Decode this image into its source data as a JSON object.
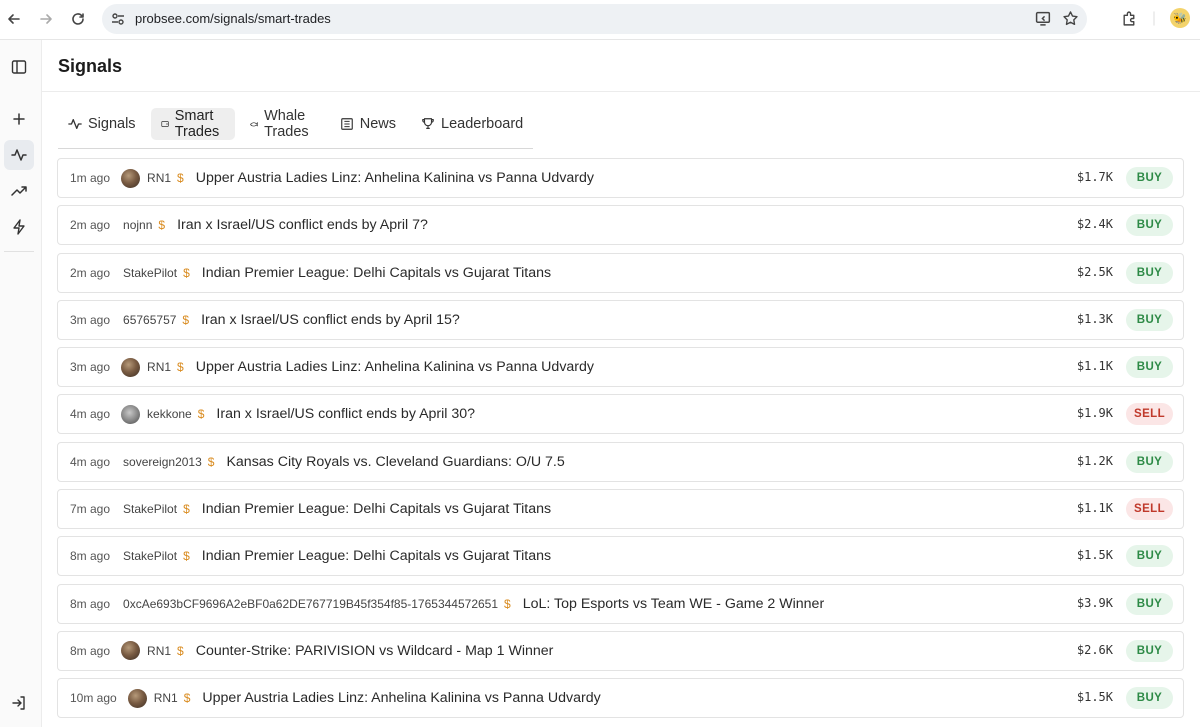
{
  "browser": {
    "url": "probsee.com/signals/smart-trades"
  },
  "page": {
    "title": "Signals"
  },
  "tabs": [
    {
      "label": "Signals",
      "icon": "activity-icon"
    },
    {
      "label": "Smart Trades",
      "icon": "wallet-icon",
      "active": true
    },
    {
      "label": "Whale Trades",
      "icon": "whale-icon"
    },
    {
      "label": "News",
      "icon": "newspaper-icon"
    },
    {
      "label": "Leaderboard",
      "icon": "trophy-icon"
    }
  ],
  "colors": {
    "buy_text": "#2d8a46",
    "buy_bg": "#e6f5ea",
    "sell_text": "#c0392b",
    "sell_bg": "#fbe6e6",
    "dollar_accent": "#d98b1f"
  },
  "trades": [
    {
      "time": "1m ago",
      "user": "RN1",
      "avatar": "brown",
      "market": "Upper Austria Ladies Linz: Anhelina Kalinina vs Panna Udvardy",
      "amount": "$1.7K",
      "side": "BUY"
    },
    {
      "time": "2m ago",
      "user": "nojnn",
      "avatar": "",
      "market": "Iran x Israel/US conflict ends by April 7?",
      "amount": "$2.4K",
      "side": "BUY"
    },
    {
      "time": "2m ago",
      "user": "StakePilot",
      "avatar": "",
      "market": "Indian Premier League: Delhi Capitals vs Gujarat Titans",
      "amount": "$2.5K",
      "side": "BUY"
    },
    {
      "time": "3m ago",
      "user": "65765757",
      "avatar": "",
      "market": "Iran x Israel/US conflict ends by April 15?",
      "amount": "$1.3K",
      "side": "BUY"
    },
    {
      "time": "3m ago",
      "user": "RN1",
      "avatar": "brown",
      "market": "Upper Austria Ladies Linz: Anhelina Kalinina vs Panna Udvardy",
      "amount": "$1.1K",
      "side": "BUY"
    },
    {
      "time": "4m ago",
      "user": "kekkone",
      "avatar": "grey",
      "market": "Iran x Israel/US conflict ends by April 30?",
      "amount": "$1.9K",
      "side": "SELL"
    },
    {
      "time": "4m ago",
      "user": "sovereign2013",
      "avatar": "",
      "market": "Kansas City Royals vs. Cleveland Guardians: O/U 7.5",
      "amount": "$1.2K",
      "side": "BUY"
    },
    {
      "time": "7m ago",
      "user": "StakePilot",
      "avatar": "",
      "market": "Indian Premier League: Delhi Capitals vs Gujarat Titans",
      "amount": "$1.1K",
      "side": "SELL"
    },
    {
      "time": "8m ago",
      "user": "StakePilot",
      "avatar": "",
      "market": "Indian Premier League: Delhi Capitals vs Gujarat Titans",
      "amount": "$1.5K",
      "side": "BUY"
    },
    {
      "time": "8m ago",
      "user": "0xcAe693bCF9696A2eBF0a62DE767719B45f354f85-1765344572651",
      "avatar": "",
      "market": "LoL: Top Esports vs Team WE - Game 2 Winner",
      "amount": "$3.9K",
      "side": "BUY"
    },
    {
      "time": "8m ago",
      "user": "RN1",
      "avatar": "brown",
      "market": "Counter-Strike: PARIVISION vs Wildcard - Map 1 Winner",
      "amount": "$2.6K",
      "side": "BUY"
    },
    {
      "time": "10m ago",
      "user": "RN1",
      "avatar": "brown",
      "market": "Upper Austria Ladies Linz: Anhelina Kalinina vs Panna Udvardy",
      "amount": "$1.5K",
      "side": "BUY"
    }
  ]
}
